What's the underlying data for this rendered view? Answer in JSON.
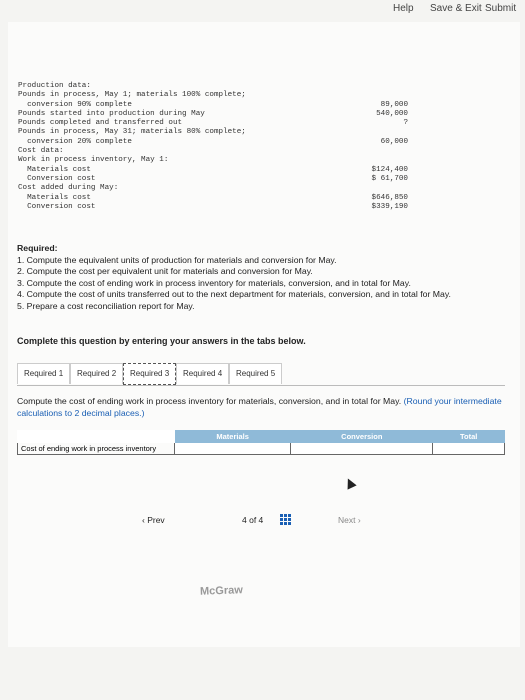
{
  "topbar": {
    "help": "Help",
    "save_exit": "Save & Exit",
    "submit": "Submit"
  },
  "production_data": [
    {
      "label": "Production data:",
      "value": ""
    },
    {
      "label": "Pounds in process, May 1; materials 100% complete;",
      "value": ""
    },
    {
      "label": "  conversion 90% complete",
      "value": "89,000"
    },
    {
      "label": "Pounds started into production during May",
      "value": "540,000"
    },
    {
      "label": "Pounds completed and transferred out",
      "value": "?"
    },
    {
      "label": "Pounds in process, May 31; materials 80% complete;",
      "value": ""
    },
    {
      "label": "  conversion 20% complete",
      "value": "60,000"
    },
    {
      "label": "Cost data:",
      "value": ""
    },
    {
      "label": "Work in process inventory, May 1:",
      "value": ""
    },
    {
      "label": "  Materials cost",
      "value": "$124,400"
    },
    {
      "label": "  Conversion cost",
      "value": "$ 61,700"
    },
    {
      "label": "Cost added during May:",
      "value": ""
    },
    {
      "label": "  Materials cost",
      "value": "$646,850"
    },
    {
      "label": "  Conversion cost",
      "value": "$339,190"
    }
  ],
  "required": {
    "heading": "Required:",
    "items": [
      "1. Compute the equivalent units of production for materials and conversion for May.",
      "2. Compute the cost per equivalent unit for materials and conversion for May.",
      "3. Compute the cost of ending work in process inventory for materials, conversion, and in total for May.",
      "4. Compute the cost of units transferred out to the next department for materials, conversion, and in total for May.",
      "5. Prepare a cost reconciliation report for May."
    ]
  },
  "complete_heading": "Complete this question by entering your answers in the tabs below.",
  "tabs": [
    "Required 1",
    "Required 2",
    "Required 3",
    "Required 4",
    "Required 5"
  ],
  "active_tab": "Required 3",
  "instructions": {
    "text": "Compute the cost of ending work in process inventory for materials, conversion, and in total for May.",
    "note": "(Round your intermediate calculations to 2 decimal places.)"
  },
  "table": {
    "headers": [
      "Materials",
      "Conversion",
      "Total"
    ],
    "row_label": "Cost of ending work in process inventory",
    "values": [
      "",
      "",
      ""
    ]
  },
  "navigation": {
    "prev": "Prev",
    "page": "4 of 4",
    "next": "Next"
  },
  "brand": "McGraw"
}
